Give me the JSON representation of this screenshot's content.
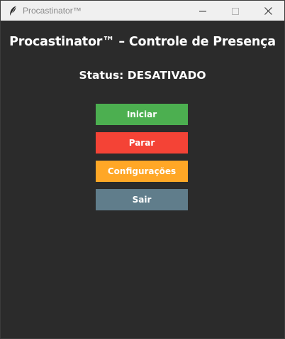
{
  "window": {
    "title": "Procastinator™"
  },
  "main": {
    "heading": "Procastinator™ – Controle de Presença",
    "status": "Status: DESATIVADO"
  },
  "buttons": {
    "start_label": "Iniciar",
    "stop_label": "Parar",
    "settings_label": "Configurações",
    "exit_label": "Sair"
  },
  "icons": {
    "app": "feather-icon",
    "minimize": "minimize-icon",
    "maximize": "maximize-icon",
    "close": "close-icon"
  },
  "colors": {
    "background": "#2b2b2b",
    "start": "#4caf50",
    "stop": "#f44336",
    "settings": "#ffa726",
    "exit": "#607d8b"
  }
}
